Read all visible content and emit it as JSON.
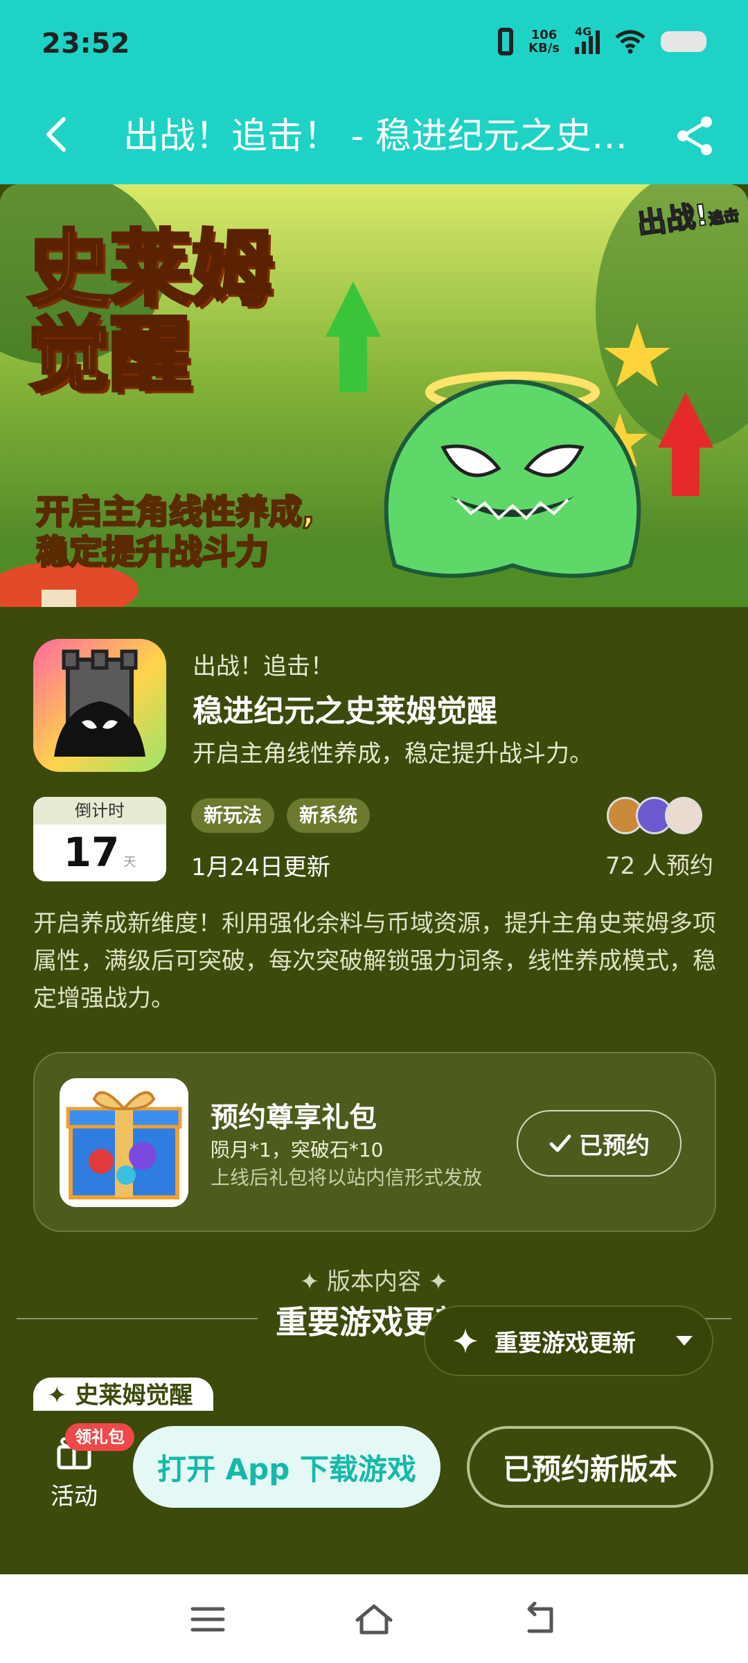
{
  "status_bar": {
    "time": "23:52",
    "net_speed": "106",
    "net_unit": "KB/s",
    "network": "4G"
  },
  "header": {
    "title": "出战！追击！ - 稳进纪元之史莱姆觉醒"
  },
  "banner": {
    "title": "史莱姆觉醒",
    "subtitle_line1": "开启主角线性养成,",
    "subtitle_line2": "稳定提升战斗力",
    "logo_text": "出战!",
    "logo_small": "追击"
  },
  "app": {
    "series": "出战！追击！",
    "name": "稳进纪元之史莱姆觉醒",
    "tagline": "开启主角线性养成，稳定提升战斗力。"
  },
  "countdown": {
    "label": "倒计时",
    "days": "17",
    "unit": "天"
  },
  "tags": [
    "新玩法",
    "新系统"
  ],
  "update_date": "1月24日更新",
  "reservations": "72 人预约",
  "description": "开启养成新维度！利用强化余料与币域资源，提升主角史莱姆多项属性，满级后可突破，每次突破解锁强力词条，线性养成模式，稳定增强战力。",
  "gift": {
    "title": "预约尊享礼包",
    "items": "陨月*1，突破石*10",
    "note": "上线后礼包将以站内信形式发放",
    "button": "已预约"
  },
  "section": {
    "label": "✦ 版本内容 ✦",
    "title": "重要游戏更新",
    "floating": "重要游戏更新",
    "chip": "✦ 史莱姆觉醒"
  },
  "bottom": {
    "activity_label": "活动",
    "badge": "领礼包",
    "open_button": "打开 App 下载游戏",
    "reserved_button": "已预约新版本"
  },
  "colors": {
    "accent": "#1ed2c6",
    "background": "#3c4a0b",
    "card": "#4d5b1d",
    "open_text": "#14b9a8"
  }
}
